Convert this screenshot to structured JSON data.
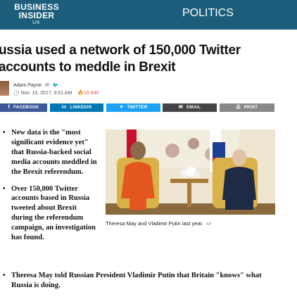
{
  "header": {
    "logo_line1": "BUSINESS",
    "logo_line2": "INSIDER",
    "logo_line3": "UK",
    "section": "POLITICS"
  },
  "article": {
    "headline": "ussia used a network of 150,000 Twitter accounts to meddle in Brexit",
    "author": "Adam Payne",
    "date": "Nov. 15, 2017, 9:01 AM",
    "views": "10,640"
  },
  "share": {
    "facebook": "FACEBOOK",
    "linkedin": "LINKEDIN",
    "twitter": "TWITTER",
    "email": "EMAIL",
    "print": "PRINT"
  },
  "bullets": [
    "New data is the \"most significant evidence yet\" that Russia-backed social media accounts meddled in the Brexit referendum.",
    "Over 150,000 Twitter accounts based in Russia tweeted about Brexit during the referendum campaign, an investigation has found.",
    "Theresa May told Russian President Vladimir Putin that Britain \"knows\" what Russia is doing."
  ],
  "photo": {
    "caption": "Theresa May and Vladimir Putin last year.",
    "credit": "AP"
  },
  "colors": {
    "brand": "#1b5d7a",
    "facebook": "#3b5998",
    "linkedin": "#0077b5",
    "twitter": "#1da1f2"
  }
}
